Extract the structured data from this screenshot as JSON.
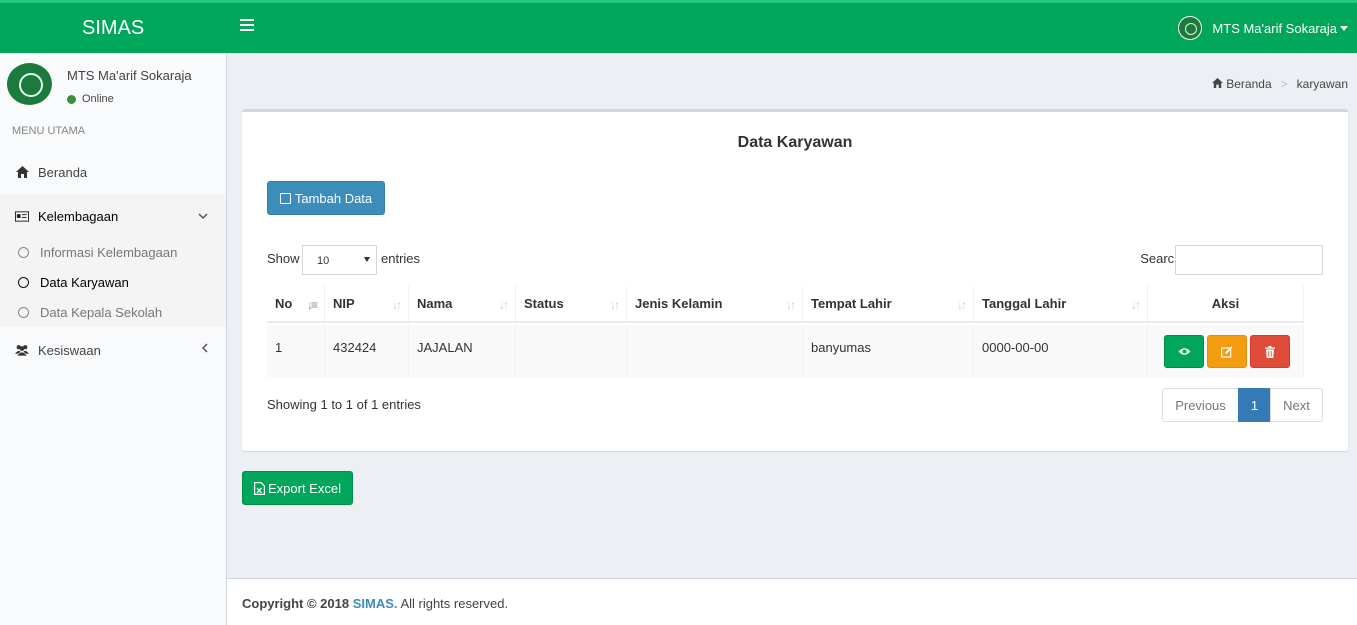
{
  "app": {
    "title": "SIMAS"
  },
  "header": {
    "user_name": "MTS Ma'arif Sokaraja"
  },
  "sidebar": {
    "user_name": "MTS Ma'arif Sokaraja",
    "status": "Online",
    "menu_header": "MENU UTAMA",
    "items": [
      {
        "label": "Beranda",
        "icon": "home-icon"
      },
      {
        "label": "Kelembagaan",
        "icon": "id-card-icon"
      },
      {
        "label": "Kesiswaan",
        "icon": "users-icon"
      }
    ],
    "submenu": [
      {
        "label": "Informasi Kelembagaan"
      },
      {
        "label": "Data Karyawan"
      },
      {
        "label": "Data Kepala Sekolah"
      }
    ]
  },
  "breadcrumb": {
    "home": "Beranda",
    "current": "karyawan"
  },
  "content": {
    "title": "Data Karyawan",
    "add_button": "Tambah Data",
    "show_label": "Show",
    "page_length": "10",
    "entries_label": "entries",
    "search_label": "Search:",
    "columns": [
      "No",
      "NIP",
      "Nama",
      "Status",
      "Jenis Kelamin",
      "Tempat Lahir",
      "Tanggal Lahir",
      "Aksi"
    ],
    "rows": [
      {
        "no": "1",
        "nip": "432424",
        "nama": "JAJALAN",
        "status": "",
        "jenis_kelamin": "",
        "tempat_lahir": "banyumas",
        "tanggal_lahir": "0000-00-00"
      }
    ],
    "info": "Showing 1 to 1 of 1 entries",
    "pagination": {
      "previous": "Previous",
      "current": "1",
      "next": "Next"
    },
    "export_button": "Export Excel"
  },
  "footer": {
    "prefix": "Copyright © 2018",
    "brand": "SIMAS.",
    "suffix": "All rights reserved."
  },
  "colors": {
    "header": "#00a65a",
    "primary": "#3c8dbc",
    "success": "#00a65a",
    "warning": "#f39c12",
    "danger": "#dd4b39"
  }
}
